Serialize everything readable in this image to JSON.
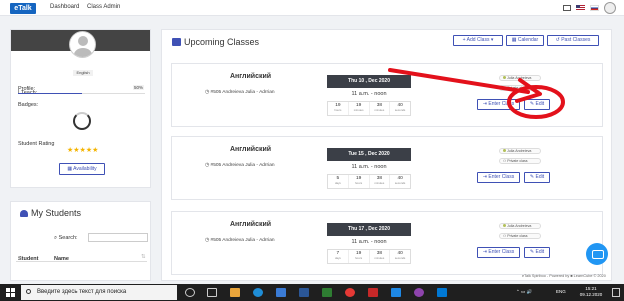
{
  "navbar": {
    "logo": "eTalk",
    "links": [
      "Dashboard",
      "Class Admin"
    ]
  },
  "profile": {
    "i_teach_label": "I Teach:",
    "language": "English",
    "profile_label": "Profile:",
    "profile_percent": "50%",
    "profile_progress": 0.5,
    "badges_label": "Badges:",
    "rating_label": "Student Rating",
    "rating_stars": "★★★★★",
    "availability_button": "Availability"
  },
  "students": {
    "title": "My Students",
    "search_label": "Search:",
    "search_value": "",
    "columns": [
      "Student",
      "Name"
    ]
  },
  "upcoming": {
    "title": "Upcoming Classes",
    "buttons": {
      "add_class": "+ Add Class",
      "calendar": "Calendar",
      "past_classes": "Past Classes"
    },
    "classes": [
      {
        "subject": "Английский",
        "teacher": "#505 Andreieva Julia - Adrrian",
        "date": "Thu 10 , Dec 2020",
        "time": "11 a.m. - noon",
        "countdown": [
          {
            "v": "19",
            "u": "hours"
          },
          {
            "v": "19",
            "u": "minutes"
          },
          {
            "v": "38",
            "u": "minutes"
          },
          {
            "v": "40",
            "u": "seconds"
          }
        ],
        "pill_user": "Julia Andreieva",
        "pill_type": "Private class",
        "enter": "Enter Class",
        "edit": "Edit"
      },
      {
        "subject": "Английский",
        "teacher": "#505 Andreieva Julia - Adrrian",
        "date": "Tue 15 , Dec 2020",
        "time": "11 a.m. - noon",
        "countdown": [
          {
            "v": "5",
            "u": "days"
          },
          {
            "v": "19",
            "u": "hours"
          },
          {
            "v": "38",
            "u": "minutes"
          },
          {
            "v": "40",
            "u": "seconds"
          }
        ],
        "pill_user": "Julia Andreieva",
        "pill_type": "Private class",
        "enter": "Enter Class",
        "edit": "Edit"
      },
      {
        "subject": "Английский",
        "teacher": "#505 Andreieva Julia - Adrrian",
        "date": "Thu 17 , Dec 2020",
        "time": "11 a.m. - noon",
        "countdown": [
          {
            "v": "7",
            "u": "days"
          },
          {
            "v": "19",
            "u": "hours"
          },
          {
            "v": "38",
            "u": "minutes"
          },
          {
            "v": "40",
            "u": "seconds"
          }
        ],
        "pill_user": "Julia Andreieva",
        "pill_type": "Private class",
        "enter": "Enter Class",
        "edit": "Edit"
      }
    ]
  },
  "footer_note": "eTalk Spiriboo - Powered by ■ LearnCube © 2020",
  "taskbar": {
    "search_placeholder": "Введите здесь текст для поиска",
    "lang": "ENG",
    "time": "15:21",
    "date": "09.12.2020"
  },
  "colors": {
    "accent": "#3f51b5",
    "annotation": "#e3111b",
    "date_header": "#3b3f47"
  }
}
